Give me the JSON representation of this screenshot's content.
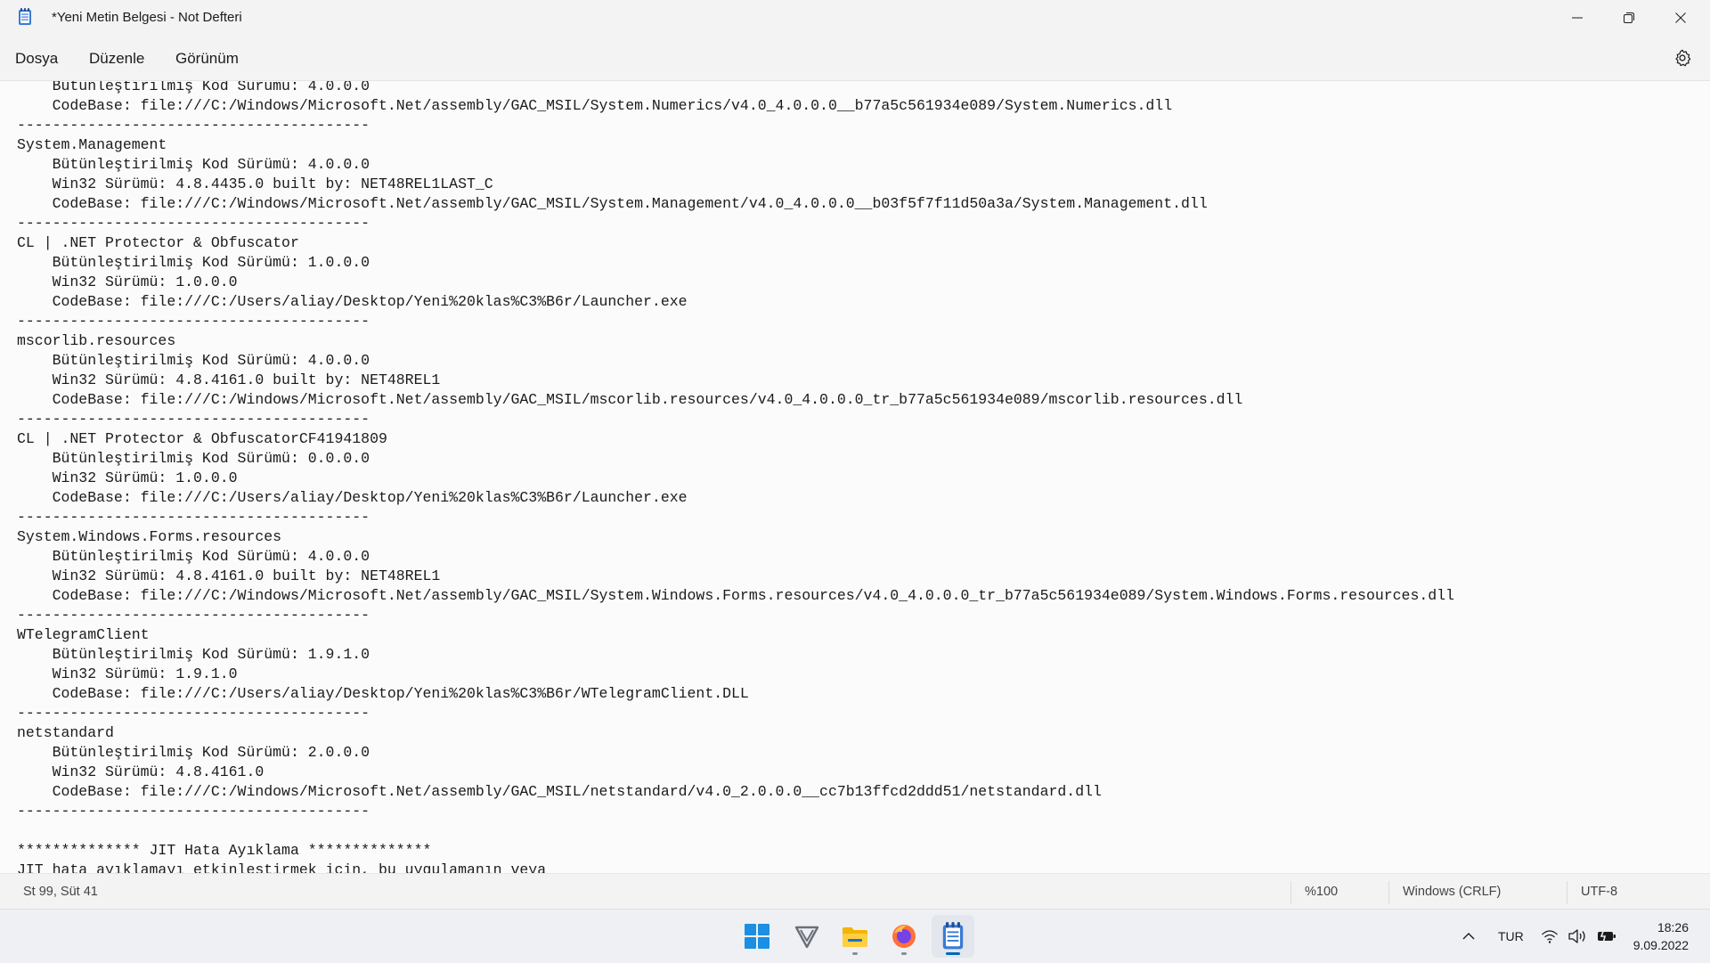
{
  "window": {
    "title": "*Yeni Metin Belgesi - Not Defteri"
  },
  "menu": {
    "file": "Dosya",
    "edit": "Düzenle",
    "view": "Görünüm"
  },
  "editor": {
    "content": "    Bütünleştirilmiş Kod Sürümü: 4.0.0.0\n    CodeBase: file:///C:/Windows/Microsoft.Net/assembly/GAC_MSIL/System.Numerics/v4.0_4.0.0.0__b77a5c561934e089/System.Numerics.dll\n----------------------------------------\nSystem.Management\n    Bütünleştirilmiş Kod Sürümü: 4.0.0.0\n    Win32 Sürümü: 4.8.4435.0 built by: NET48REL1LAST_C\n    CodeBase: file:///C:/Windows/Microsoft.Net/assembly/GAC_MSIL/System.Management/v4.0_4.0.0.0__b03f5f7f11d50a3a/System.Management.dll\n----------------------------------------\nCL | .NET Protector & Obfuscator\n    Bütünleştirilmiş Kod Sürümü: 1.0.0.0\n    Win32 Sürümü: 1.0.0.0\n    CodeBase: file:///C:/Users/aliay/Desktop/Yeni%20klas%C3%B6r/Launcher.exe\n----------------------------------------\nmscorlib.resources\n    Bütünleştirilmiş Kod Sürümü: 4.0.0.0\n    Win32 Sürümü: 4.8.4161.0 built by: NET48REL1\n    CodeBase: file:///C:/Windows/Microsoft.Net/assembly/GAC_MSIL/mscorlib.resources/v4.0_4.0.0.0_tr_b77a5c561934e089/mscorlib.resources.dll\n----------------------------------------\nCL | .NET Protector & ObfuscatorCF41941809\n    Bütünleştirilmiş Kod Sürümü: 0.0.0.0\n    Win32 Sürümü: 1.0.0.0\n    CodeBase: file:///C:/Users/aliay/Desktop/Yeni%20klas%C3%B6r/Launcher.exe\n----------------------------------------\nSystem.Windows.Forms.resources\n    Bütünleştirilmiş Kod Sürümü: 4.0.0.0\n    Win32 Sürümü: 4.8.4161.0 built by: NET48REL1\n    CodeBase: file:///C:/Windows/Microsoft.Net/assembly/GAC_MSIL/System.Windows.Forms.resources/v4.0_4.0.0.0_tr_b77a5c561934e089/System.Windows.Forms.resources.dll\n----------------------------------------\nWTelegramClient\n    Bütünleştirilmiş Kod Sürümü: 1.9.1.0\n    Win32 Sürümü: 1.9.1.0\n    CodeBase: file:///C:/Users/aliay/Desktop/Yeni%20klas%C3%B6r/WTelegramClient.DLL\n----------------------------------------\nnetstandard\n    Bütünleştirilmiş Kod Sürümü: 2.0.0.0\n    Win32 Sürümü: 4.8.4161.0\n    CodeBase: file:///C:/Windows/Microsoft.Net/assembly/GAC_MSIL/netstandard/v4.0_2.0.0.0__cc7b13ffcd2ddd51/netstandard.dll\n----------------------------------------\n\n************** JIT Hata Ayıklama **************\nJIT hata ayıklamayı etkinleştirmek için, bu uygulamanın veya\nbilgisayarın (machine.config) .config dosyasında"
  },
  "status": {
    "position": "St 99, Süt 41",
    "zoom": "%100",
    "line_ending": "Windows (CRLF)",
    "encoding": "UTF-8"
  },
  "tray": {
    "language": "TUR",
    "time": "18:26",
    "date": "9.09.2022"
  },
  "taskbar": {
    "apps": [
      "start",
      "vivaldi",
      "file-explorer",
      "firefox",
      "notepad"
    ]
  },
  "colors": {
    "accent": "#0067c0",
    "chrome": "#f3f3f3",
    "editor_bg": "#fbfbfb"
  }
}
